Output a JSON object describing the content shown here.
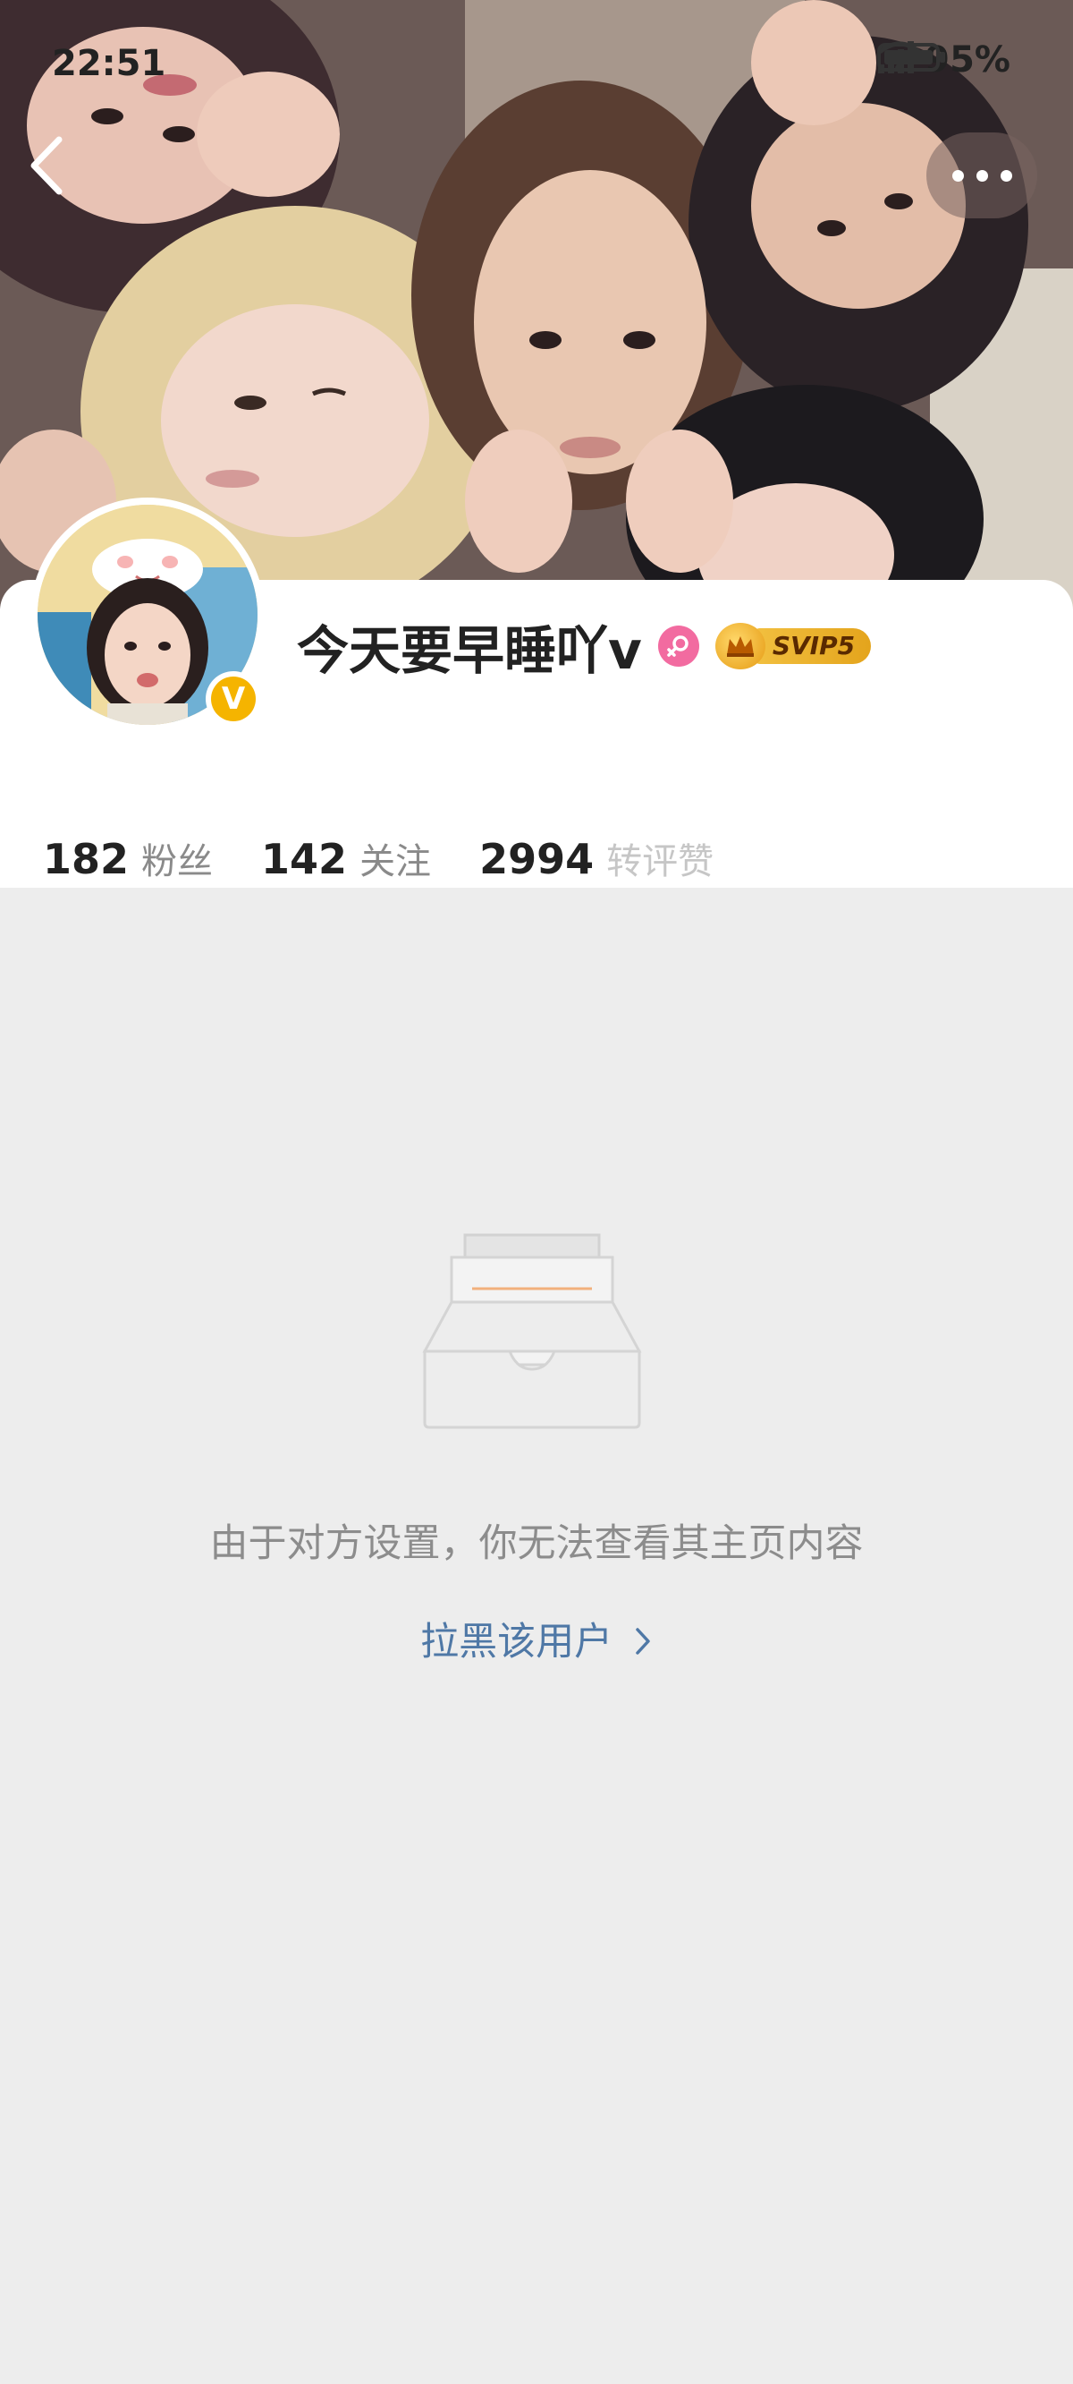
{
  "status_bar": {
    "time": "22:51",
    "battery_percent": "95%",
    "icons": [
      "wifi-icon",
      "signal-icon",
      "battery-icon"
    ]
  },
  "header": {
    "back_icon": "chevron-left-icon",
    "more_icon": "more-horizontal-icon"
  },
  "profile": {
    "username": "今天要早睡吖v",
    "gender_icon": "female-icon",
    "vip_badge": "SVIP5",
    "verified_badge": "V",
    "stats": [
      {
        "value": "182",
        "label": "粉丝"
      },
      {
        "value": "142",
        "label": "关注"
      },
      {
        "value": "2994",
        "label": "转评赞"
      }
    ]
  },
  "empty_state": {
    "icon": "empty-inbox-icon",
    "message": "由于对方设置，你无法查看其主页内容",
    "action_label": "拉黑该用户",
    "action_icon": "chevron-right-icon"
  },
  "colors": {
    "background": "#ededed",
    "link": "#4f78a6",
    "gender": "#f26ba0",
    "vip_gold": "#e4a41c",
    "verified": "#f5b400"
  }
}
